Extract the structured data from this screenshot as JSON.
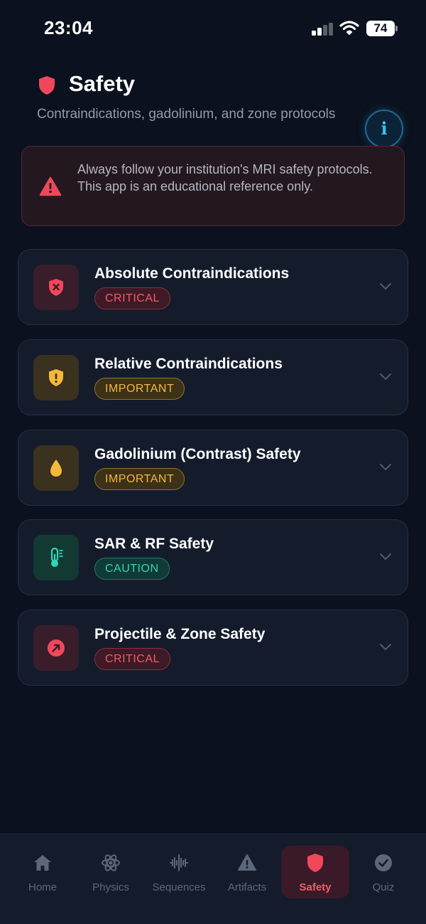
{
  "status_bar": {
    "time": "23:04",
    "battery": "74"
  },
  "header": {
    "title": "Safety",
    "subtitle": "Contraindications, gadolinium, and zone protocols",
    "info_label": "i",
    "icon": "shield-icon"
  },
  "disclaimer": {
    "text": "Always follow your institution's MRI safety protocols. This app is an educational reference only.",
    "icon": "warning-triangle-icon"
  },
  "sections": [
    {
      "title": "Absolute Contraindications",
      "badge": "CRITICAL",
      "level": "critical",
      "icon": "shield-x-icon"
    },
    {
      "title": "Relative Contraindications",
      "badge": "IMPORTANT",
      "level": "important",
      "icon": "shield-alert-icon"
    },
    {
      "title": "Gadolinium (Contrast) Safety",
      "badge": "IMPORTANT",
      "level": "important",
      "icon": "droplet-icon"
    },
    {
      "title": "SAR & RF Safety",
      "badge": "CAUTION",
      "level": "caution",
      "icon": "thermometer-icon"
    },
    {
      "title": "Projectile & Zone Safety",
      "badge": "CRITICAL",
      "level": "critical",
      "icon": "arrow-up-right-circle-icon"
    }
  ],
  "tabs": [
    {
      "label": "Home",
      "icon": "home-icon"
    },
    {
      "label": "Physics",
      "icon": "atom-icon"
    },
    {
      "label": "Sequences",
      "icon": "waveform-icon"
    },
    {
      "label": "Artifacts",
      "icon": "warning-icon"
    },
    {
      "label": "Safety",
      "icon": "shield-icon",
      "active": true
    },
    {
      "label": "Quiz",
      "icon": "check-circle-icon"
    }
  ],
  "colors": {
    "background": "#0b111e",
    "card": "#141c2c",
    "critical": "#f25a6a",
    "important": "#f5b83a",
    "caution": "#35d4b4",
    "accent_info": "#38c3f0"
  }
}
